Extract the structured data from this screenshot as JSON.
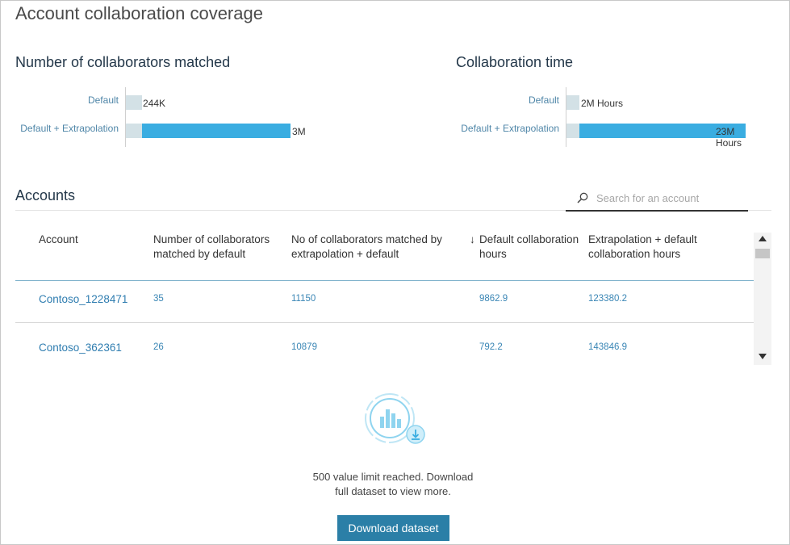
{
  "page": {
    "title": "Account collaboration coverage"
  },
  "charts": {
    "collaborators": {
      "title": "Number of collaborators matched",
      "categories": [
        "Default",
        "Default + Extrapolation"
      ],
      "value_labels": [
        "244K",
        "3M"
      ],
      "values": [
        244000,
        3000000
      ]
    },
    "time": {
      "title": "Collaboration time",
      "categories": [
        "Default",
        "Default + Extrapolation"
      ],
      "value_labels": [
        "2M Hours",
        "23M Hours"
      ],
      "values": [
        2000000,
        23000000
      ]
    }
  },
  "chart_data": [
    {
      "type": "bar",
      "title": "Number of collaborators matched",
      "categories": [
        "Default",
        "Default + Extrapolation"
      ],
      "values": [
        244000,
        3000000
      ],
      "data_labels": [
        "244K",
        "3M"
      ]
    },
    {
      "type": "bar",
      "title": "Collaboration time",
      "categories": [
        "Default",
        "Default + Extrapolation"
      ],
      "values": [
        2000000,
        23000000
      ],
      "data_labels": [
        "2M Hours",
        "23M Hours"
      ]
    }
  ],
  "accounts": {
    "title": "Accounts",
    "search_placeholder": "Search for an account",
    "columns": {
      "account": "Account",
      "matched_default": "Number of collaborators matched by default",
      "matched_extrap": "No of collaborators matched by extrapolation + default",
      "default_hours": "Default collaboration hours",
      "extrap_hours": "Extrapolation + default collaboration hours"
    },
    "sort_indicator": "↓",
    "rows": [
      {
        "account": "Contoso_1228471",
        "matched_default": "35",
        "matched_extrap": "11150",
        "default_hours": "9862.9",
        "extrap_hours": "123380.2"
      },
      {
        "account": "Contoso_362361",
        "matched_default": "26",
        "matched_extrap": "10879",
        "default_hours": "792.2",
        "extrap_hours": "143846.9"
      }
    ]
  },
  "limit": {
    "message_line1": "500 value limit reached. Download",
    "message_line2": "full dataset to view more.",
    "button_label": "Download dataset"
  },
  "colors": {
    "bar_default": "#d3e1e6",
    "bar_extrapolation": "#3aade1",
    "button": "#2b7fa7",
    "link": "#2f7db0"
  }
}
